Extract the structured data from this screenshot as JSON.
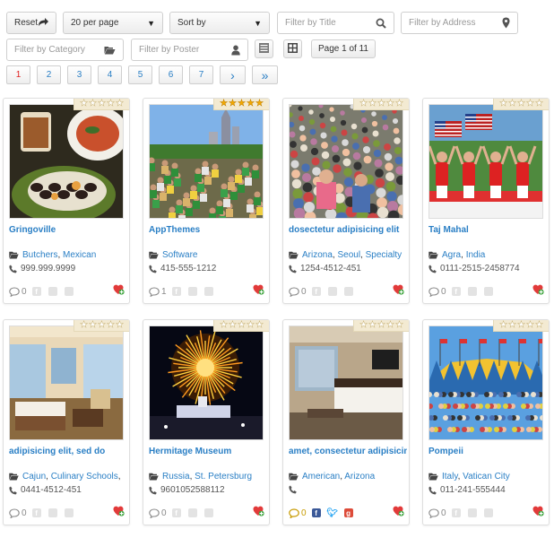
{
  "toolbar": {
    "reset_label": "Reset",
    "per_page": "20 per page",
    "sort_by": "Sort by",
    "filter_title_placeholder": "Filter by Title",
    "filter_address_placeholder": "Filter by Address",
    "filter_category_placeholder": "Filter by Category",
    "filter_poster_placeholder": "Filter by Poster",
    "page_info": "Page 1 of 11"
  },
  "pagination": {
    "pages": [
      "1",
      "2",
      "3",
      "4",
      "5",
      "6",
      "7"
    ],
    "next": "›",
    "last": "»",
    "active_color": "#e02020",
    "link_color": "#2a7fc5"
  },
  "listings": [
    {
      "title": "Gringoville",
      "categories": [
        "Butchers",
        "Mexican"
      ],
      "phone": "999.999.9999",
      "comments": "0",
      "rating": 0,
      "photo": "food"
    },
    {
      "title": "AppThemes",
      "categories": [
        "Software"
      ],
      "phone": "415-555-1212",
      "comments": "1",
      "rating": 5,
      "photo": "city"
    },
    {
      "title": "dosectetur adipisicing elit",
      "categories": [
        "Arizona",
        "Seoul",
        "Specialty"
      ],
      "phone": "1254-4512-451",
      "comments": "0",
      "rating": 0,
      "photo": "crowd"
    },
    {
      "title": "Taj Mahal",
      "categories": [
        "Agra",
        "India"
      ],
      "phone": "0111-2515-2458774",
      "comments": "0",
      "rating": 0,
      "photo": "parade"
    },
    {
      "title": "adipisicing elit, sed do",
      "categories": [
        "Cajun",
        "Culinary Schools",
        ""
      ],
      "phone": "0441-4512-451",
      "comments": "0",
      "rating": 0,
      "photo": "hotel"
    },
    {
      "title": "Hermitage Museum",
      "categories": [
        "Russia",
        "St. Petersburg"
      ],
      "phone": "9601052588112",
      "comments": "0",
      "rating": 0,
      "photo": "fireworks"
    },
    {
      "title": "amet, consectetur adipisicing",
      "categories": [
        "American",
        "Arizona"
      ],
      "phone": "",
      "comments": "0",
      "rating": 0,
      "photo": "bedroom",
      "social_active": true
    },
    {
      "title": "Pompeii",
      "categories": [
        "Italy",
        "Vatican City"
      ],
      "phone": "011-241-555444",
      "comments": "0",
      "rating": 0,
      "photo": "tent"
    }
  ]
}
